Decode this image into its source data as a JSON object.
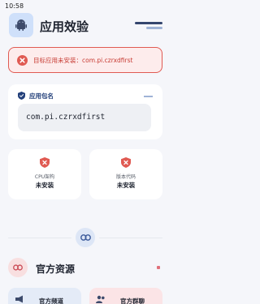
{
  "status_bar": {
    "time": "10:58"
  },
  "header": {
    "title": "应用效验"
  },
  "error_banner": {
    "message": "目标应用未安装：com.pi.czrxdfirst"
  },
  "package_card": {
    "label": "应用包名",
    "value": "com.pi.czrxdfirst"
  },
  "info_cards": [
    {
      "label": "CPU架构",
      "value": "未安装"
    },
    {
      "label": "版本代码",
      "value": "未安装"
    }
  ],
  "resources": {
    "title": "官方资源",
    "buttons": [
      {
        "label": "官方频道"
      },
      {
        "label": "官方群聊"
      }
    ]
  },
  "colors": {
    "accent": "#23407a",
    "error": "#e05a52",
    "background": "#f5f6fa"
  }
}
